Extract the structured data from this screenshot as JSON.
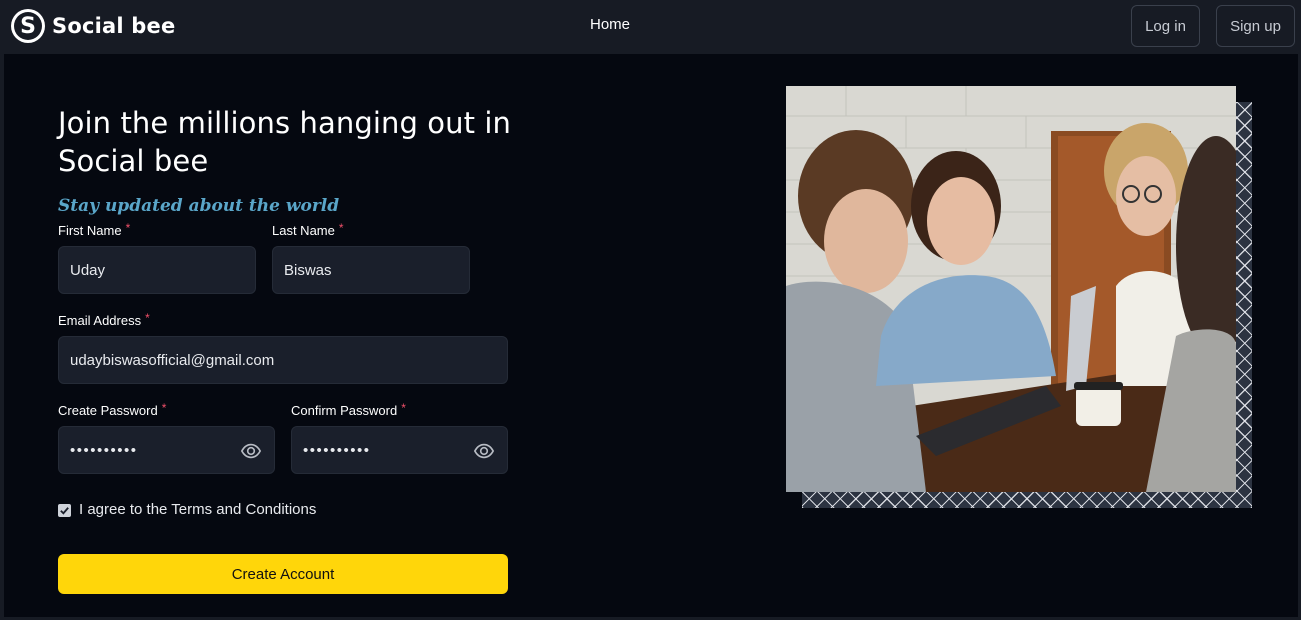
{
  "brand": {
    "logo_letter": "S",
    "name": "Social bee"
  },
  "nav": {
    "home": "Home",
    "login": "Log in",
    "signup": "Sign up"
  },
  "hero": {
    "headline": "Join the millions hanging out in Social bee",
    "tagline": "Stay updated about the world"
  },
  "form": {
    "first_name": {
      "label": "First Name",
      "required_mark": "*",
      "value": "Uday"
    },
    "last_name": {
      "label": "Last Name",
      "required_mark": "*",
      "value": "Biswas"
    },
    "email": {
      "label": "Email Address",
      "required_mark": "*",
      "value": "udaybiswasofficial@gmail.com"
    },
    "password": {
      "label": "Create Password",
      "required_mark": "*",
      "masked_value": "••••••••••",
      "visibility_icon": "eye-icon"
    },
    "confirm_password": {
      "label": "Confirm Password",
      "required_mark": "*",
      "masked_value": "••••••••••",
      "visibility_icon": "eye-icon"
    },
    "terms": {
      "label": "I agree to the Terms and Conditions",
      "checked": true
    },
    "submit": "Create Account"
  },
  "colors": {
    "accent_button": "#ffd60a",
    "tagline": "#5aa6c9",
    "required": "#f1506a",
    "background": "#050810",
    "navbar": "#171b24"
  }
}
